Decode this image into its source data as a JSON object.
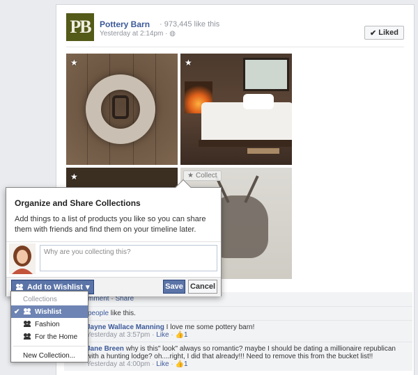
{
  "post": {
    "logo_text": "PB",
    "page_name": "Pottery Barn",
    "likes": "· 973,445 like this",
    "meta": "Yesterday at 2:14pm · ◍",
    "liked_label": "Liked"
  },
  "photos": {
    "collect_label": "Collect"
  },
  "collect_dialog": {
    "title": "Organize and Share Collections",
    "description": "Add things to a list of products you like so you can share them with friends and find them on your timeline later.",
    "input_placeholder": "Why are you collecting this?",
    "add_button": "Add to Wishlist",
    "save_button": "Save",
    "cancel_button": "Cancel"
  },
  "collections_menu": {
    "header": "Collections",
    "items": [
      {
        "label": "Wishlist",
        "selected": true
      },
      {
        "label": "Fashion",
        "selected": false
      },
      {
        "label": "For the Home",
        "selected": false
      }
    ],
    "new_collection": "New Collection..."
  },
  "feedback": {
    "comment_link": "mment",
    "share_link": "Share",
    "people_link": "people",
    "likes_suffix": " like this.",
    "comments": [
      {
        "author": "Jayne Wallace Manning",
        "text": " I love me some pottery barn!",
        "time": "Yesterday at 3:57pm",
        "like": "Like",
        "like_count": "1"
      },
      {
        "author": "Jane Breen",
        "text": " why is this\" look\" always so romantic? maybe I should be dating a millionaire republican with a hunting lodge? oh....right, I did that already!!! Need to remove this from the bucket list!!",
        "time": "Yesterday at 4:00pm",
        "like": "Like",
        "like_count": "1"
      }
    ]
  },
  "colors": {
    "facebook_blue": "#3b5998",
    "button_blue": "#5b74a8",
    "menu_selected": "#6d84b4",
    "logo_olive": "#545a18"
  }
}
